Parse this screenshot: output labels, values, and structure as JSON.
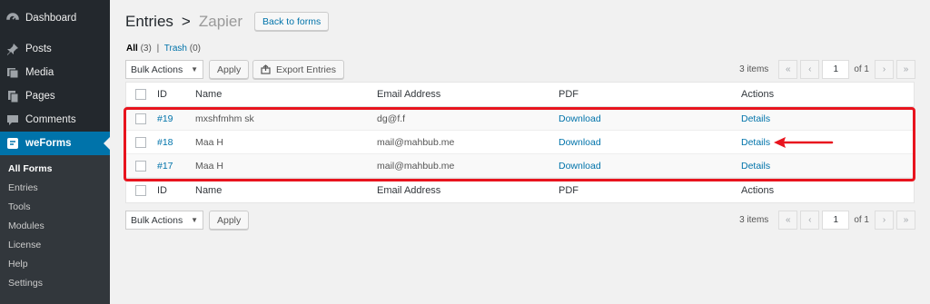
{
  "sidebar": {
    "items": [
      {
        "label": "Dashboard",
        "icon": "dashboard-icon"
      },
      {
        "label": "Posts",
        "icon": "pin-icon"
      },
      {
        "label": "Media",
        "icon": "media-icon"
      },
      {
        "label": "Pages",
        "icon": "pages-icon"
      },
      {
        "label": "Comments",
        "icon": "comment-icon"
      },
      {
        "label": "weForms",
        "icon": "weforms-icon",
        "active": true
      }
    ],
    "submenu": [
      "All Forms",
      "Entries",
      "Tools",
      "Modules",
      "License",
      "Help",
      "Settings"
    ]
  },
  "header": {
    "title": "Entries",
    "separator": ">",
    "form_name": "Zapier",
    "back_label": "Back to forms"
  },
  "views": {
    "all_label": "All",
    "all_count": "(3)",
    "sep": "|",
    "trash_label": "Trash",
    "trash_count": "(0)"
  },
  "top_nav": {
    "bulk_label": "Bulk Actions",
    "apply_label": "Apply",
    "export_label": "Export Entries"
  },
  "bottom_nav": {
    "bulk_label": "Bulk Actions",
    "apply_label": "Apply"
  },
  "pagination": {
    "items": "3 items",
    "first": "«",
    "prev": "‹",
    "page": "1",
    "of": "of 1",
    "next": "›",
    "last": "»"
  },
  "table": {
    "columns": [
      "ID",
      "Name",
      "Email Address",
      "PDF",
      "Actions"
    ],
    "rows": [
      {
        "id": "#19",
        "name": "mxshfmhm sk",
        "email": "dg@f.f",
        "pdf": "Download",
        "action": "Details"
      },
      {
        "id": "#18",
        "name": "Maa H",
        "email": "mail@mahbub.me",
        "pdf": "Download",
        "action": "Details"
      },
      {
        "id": "#17",
        "name": "Maa H",
        "email": "mail@mahbub.me",
        "pdf": "Download",
        "action": "Details"
      }
    ]
  },
  "colors": {
    "sidebar_bg": "#23282d",
    "active_bg": "#0073aa",
    "link": "#0073aa",
    "highlight": "#e8141e"
  }
}
